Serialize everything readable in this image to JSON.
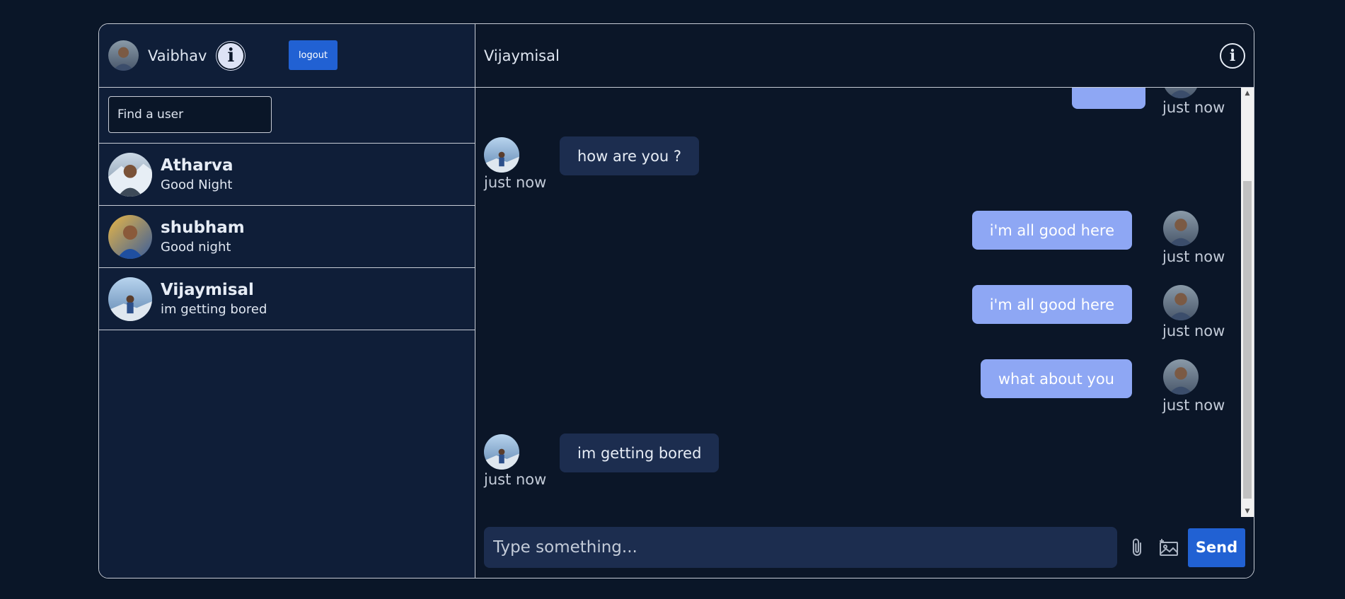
{
  "current_user": {
    "name": "Vaibhav"
  },
  "sidebar": {
    "logout_label": "logout",
    "search_placeholder": "Find a user",
    "users": [
      {
        "name": "Atharva",
        "last_message": "Good Night"
      },
      {
        "name": "shubham",
        "last_message": "Good night"
      },
      {
        "name": "Vijaymisal",
        "last_message": "im getting bored"
      }
    ]
  },
  "chat": {
    "title": "Vijaymisal",
    "messages": [
      {
        "direction": "out",
        "text": "",
        "time": "just now"
      },
      {
        "direction": "in",
        "text": "how are you ?",
        "time": "just now"
      },
      {
        "direction": "out",
        "text": "i'm all good here",
        "time": "just now"
      },
      {
        "direction": "out",
        "text": "i'm all good here",
        "time": "just now"
      },
      {
        "direction": "out",
        "text": "what about you",
        "time": "just now"
      },
      {
        "direction": "in",
        "text": "im getting bored",
        "time": "just now"
      }
    ],
    "composer": {
      "placeholder": "Type something...",
      "send_label": "Send"
    }
  },
  "colors": {
    "background": "#0a1628",
    "sidebar": "#0f1e38",
    "accent": "#2161d3",
    "bubble_out": "#8ea7f4",
    "bubble_in": "#1c2d4f"
  },
  "icons": [
    "info-icon",
    "attachment-icon",
    "image-icon",
    "avatar"
  ]
}
